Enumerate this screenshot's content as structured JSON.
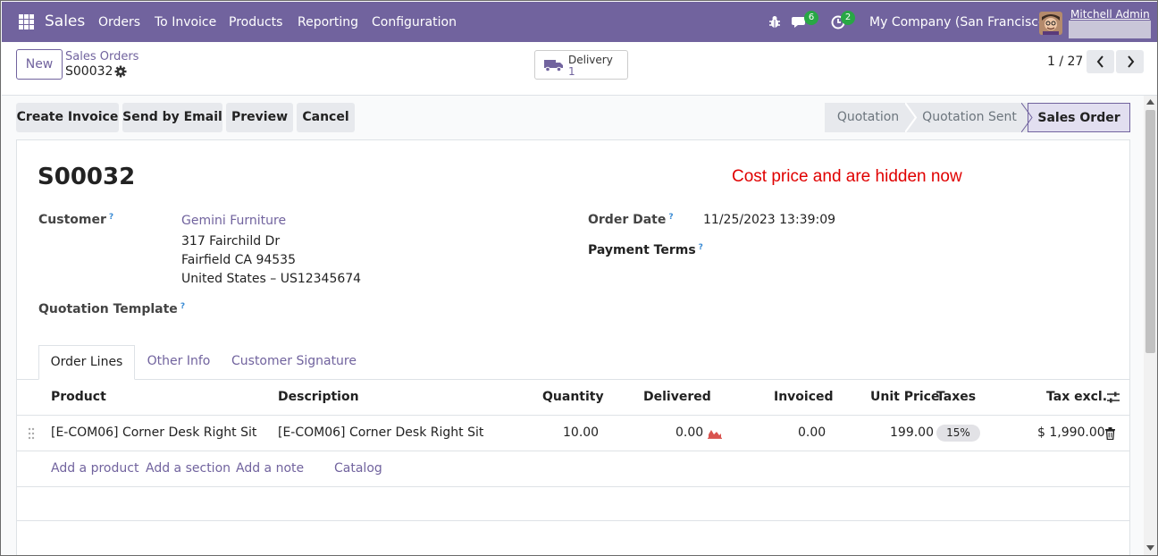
{
  "navbar": {
    "app_name": "Sales",
    "menu": [
      "Orders",
      "To Invoice",
      "Products",
      "Reporting",
      "Configuration"
    ],
    "messages_count": "6",
    "activities_count": "2",
    "company": "My Company (San Francisco)",
    "user": "Mitchell Admin"
  },
  "control": {
    "new_label": "New",
    "breadcrumb": "Sales Orders",
    "record": "S00032",
    "delivery_label": "Delivery",
    "delivery_count": "1",
    "pager": "1 / 27"
  },
  "actions": {
    "create_invoice": "Create Invoice",
    "send_email": "Send by Email",
    "preview": "Preview",
    "cancel": "Cancel"
  },
  "status": {
    "steps": [
      "Quotation",
      "Quotation Sent",
      "Sales Order"
    ],
    "active": "Sales Order"
  },
  "form": {
    "title": "S00032",
    "note": "Cost price and are hidden now",
    "customer_label": "Customer",
    "customer_name": "Gemini Furniture",
    "address_line1": "317 Fairchild Dr",
    "address_line2": "Fairfield CA 94535",
    "address_line3": "United States – US12345674",
    "quotation_template_label": "Quotation Template",
    "order_date_label": "Order Date",
    "order_date": "11/25/2023 13:39:09",
    "payment_terms_label": "Payment Terms",
    "help_mark": "?"
  },
  "tabs": [
    "Order Lines",
    "Other Info",
    "Customer Signature"
  ],
  "table": {
    "headers": [
      "Product",
      "Description",
      "Quantity",
      "Delivered",
      "Invoiced",
      "Unit Price",
      "Taxes",
      "Tax excl."
    ],
    "rows": [
      {
        "product": "[E-COM06] Corner Desk Right Sit",
        "description": "[E-COM06] Corner Desk Right Sit",
        "quantity": "10.00",
        "delivered": "0.00",
        "invoiced": "0.00",
        "unit_price": "199.00",
        "taxes": "15%",
        "tax_excl": "$ 1,990.00"
      }
    ],
    "add_links": [
      "Add a product",
      "Add a section",
      "Add a note",
      "Catalog"
    ]
  },
  "colors": {
    "brand": "#71639e",
    "note": "#e00000",
    "badge": "#28a745"
  }
}
